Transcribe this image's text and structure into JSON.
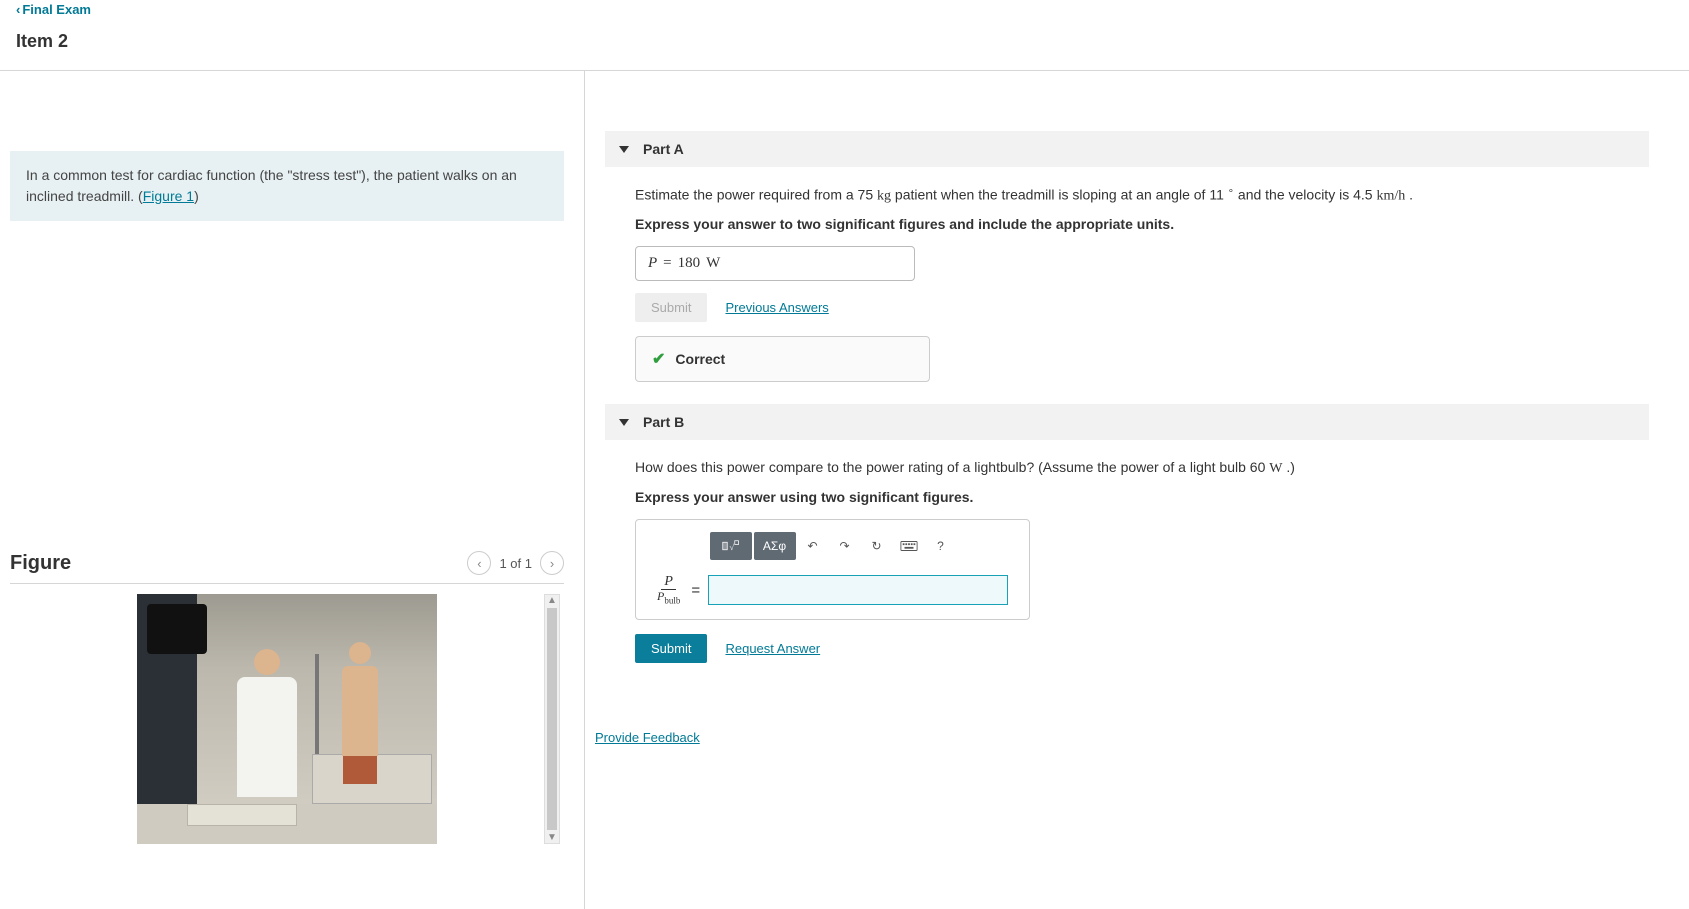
{
  "breadcrumb": "Final Exam",
  "item_title": "Item 2",
  "problem_text_prefix": "In a common test for cardiac function (the \"stress test\"), the patient walks on an inclined treadmill. (",
  "figure_link_text": "Figure 1",
  "problem_text_suffix": ")",
  "figure": {
    "title": "Figure",
    "pager": "1 of 1"
  },
  "partA": {
    "title": "Part A",
    "q_pre": "Estimate the power required from a 75 ",
    "q_kg": "kg",
    "q_mid1": " patient when the treadmill is sloping at an angle of 11 ",
    "q_deg": "∘",
    "q_mid2": " and the velocity is 4.5 ",
    "q_unit": "km/h",
    "q_end": " .",
    "instructions": "Express your answer to two significant figures and include the appropriate units.",
    "answer_var": "P",
    "answer_eq": "=",
    "answer_val": "180",
    "answer_unit": "W",
    "submit": "Submit",
    "prev_answers": "Previous Answers",
    "correct": "Correct"
  },
  "partB": {
    "title": "Part B",
    "q_pre": "How does this power compare to the power rating of a lightbulb? (Assume the power of a light bulb 60 ",
    "q_unit": "W",
    "q_end": " .)",
    "instructions": "Express your answer using two significant figures.",
    "toolbar": {
      "templates": "x√",
      "greek": "ΑΣφ",
      "undo": "↶",
      "redo": "↷",
      "reset": "↻",
      "keyboard": "⌨",
      "help": "?"
    },
    "frac_num": "P",
    "frac_den_base": "P",
    "frac_den_sub": "bulb",
    "eq": "=",
    "submit": "Submit",
    "request_answer": "Request Answer"
  },
  "provide_feedback": "Provide Feedback"
}
